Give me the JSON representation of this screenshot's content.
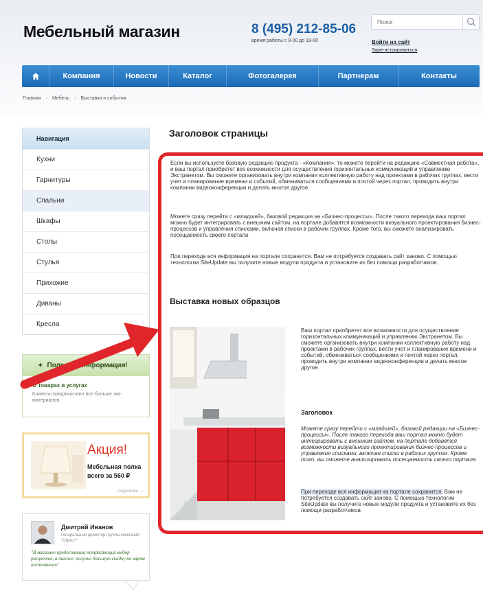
{
  "header": {
    "logo": "Мебельный магазин",
    "phone": "8 (495) 212-85-06",
    "hours": "время работы с 9-00 до 18-00",
    "search_placeholder": "Поиск",
    "login": "Войти на сайт",
    "register": "Зарегистрироваться"
  },
  "nav": {
    "items": [
      "Компания",
      "Новости",
      "Каталог",
      "Фотогалерея",
      "Партнерам",
      "Контакты"
    ]
  },
  "breadcrumb": [
    "Главная",
    "Мебель",
    "Выставки и события"
  ],
  "sidebar": {
    "title": "Навигация",
    "items": [
      "Кухни",
      "Гарнитуры",
      "Спальни",
      "Шкафы",
      "Столы",
      "Стулья",
      "Прихожие",
      "Диваны",
      "Кресла"
    ],
    "active_index": 2
  },
  "infobox": {
    "title": "Полезная информация!",
    "link": "О товарах и услугах",
    "text": "Клиенты предпочитают все больше эко-материалов."
  },
  "promo": {
    "title": "Акция!",
    "line1": "Мебельная полка",
    "line2": "всего за 560 ₽",
    "more": "подробнее →"
  },
  "review": {
    "name": "Дмитрий Иванов",
    "role": "Генеральный директор группы компаний \"Офис+\"",
    "quote": "\"В магазине предоставили потрясающий выбор расцветок, а также, получил большую скидку по карте постоянного\""
  },
  "main": {
    "title": "Заголовок страницы",
    "p1": "Если вы используете базовую редакцию продукта - «Компания», то можете перейти на редакцию «Совместная работа», и ваш портал приобретет все возможности для осуществления горизонтальных коммуникаций и управлению Экстранетом. Вы сможете организовать внутри компании коллективную работу над проектами в рабочих группах, вести учет и планирование времени и событий, обмениваться сообщениями и почтой через портал, проводить внутри компании видеоконференции и делать многое другое.",
    "p2": "Можете сразу перейти с «младшей», базовой редакции на «Бизнес-процессы». После такого перехода ваш портал можно будет интегрировать с внешним сайтом, на портале добавятся возможности визуального проектирования бизнес-процессов и управления списками, включая списки в рабочих группах. Кроме того, вы сможете анализировать посещаемость своего портала",
    "p3": "При переходе вся информация на портале сохранится. Вам не потребуется создавать сайт заново. С помощью технологии SiteUpdate вы получите новые модули продукта и установите их без помощи разработчиков.",
    "subhead": "Выставка новых образцов",
    "side_p1": "Ваш портал приобретет все возможности для осуществления горизонтальных коммуникаций и управлению Экстранетом. Вы сможете организовать внутри компании коллективную работу над проектами в рабочих группах, вести учет и планирование времени и событий, обмениваться сообщениями и почтой через портал, проводить внутри компании видеоконференции и делать многое другое.",
    "side_head": "Заголовок",
    "side_p2": "Можете сразу перейти с «младшей», базовой редакции на «Бизнес-процессы». После такого перехода ваш портал можно будет интегрировать с внешним сайтом, на портале добавятся возможности визуального проектирования бизнес-процессов и управления списками, включая списки в рабочих группах. Кроме того, вы сможете анализировать посещаемость своего портала",
    "side_p3_highlight": "При переходе вся информация на портале сохранится.",
    "side_p3_rest": " Вам не потребуется создавать сайт заново. С помощью технологии SiteUpdate вы получите новые модули продукта и установите их без помощи разработчиков."
  },
  "colors": {
    "nav_blue": "#1c69b6",
    "annotation_red": "#e0262a",
    "promo_red": "#e03327",
    "phone_blue": "#1a5fa6"
  },
  "icons": [
    "home-icon",
    "search-icon",
    "pin-icon",
    "annotation-arrow"
  ]
}
